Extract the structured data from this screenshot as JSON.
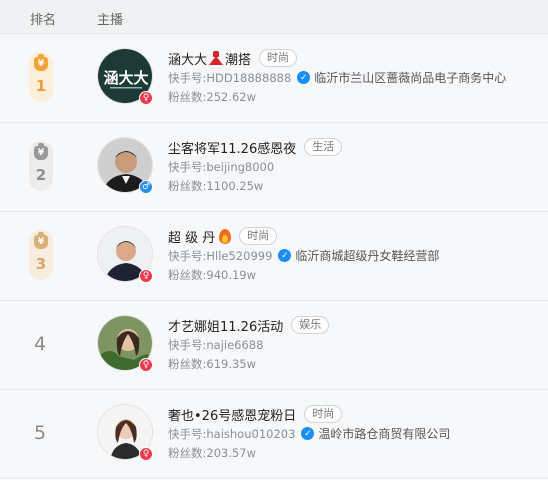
{
  "header": {
    "rank_label": "排名",
    "host_label": "主播"
  },
  "id_prefix": "快手号:",
  "fans_prefix": "粉丝数:",
  "rows": [
    {
      "rank": "1",
      "medal": "gold",
      "name": "涵大大",
      "name_suffix": "潮搭",
      "name_emoji": "dress",
      "tag": "时尚",
      "id": "HDD18888888",
      "verified": true,
      "company": "临沂市兰山区蔷薇尚品电子商务中心",
      "fans": "252.62w",
      "gender": "female",
      "avatar_text": "涵大大"
    },
    {
      "rank": "2",
      "medal": "silver",
      "name": "尘客将军11.26感恩夜",
      "tag": "生活",
      "id": "beijing8000",
      "verified": false,
      "company": "",
      "fans": "1100.25w",
      "gender": "male"
    },
    {
      "rank": "3",
      "medal": "bronze",
      "name": "超 级 丹",
      "name_emoji": "fire",
      "tag": "时尚",
      "id": "Hlle520999",
      "verified": true,
      "company": "临沂商城超级丹女鞋经营部",
      "fans": "940.19w",
      "gender": "female"
    },
    {
      "rank": "4",
      "medal": "none",
      "name": "才艺娜姐11.26活动",
      "tag": "娱乐",
      "id": "najie6688",
      "verified": false,
      "company": "",
      "fans": "619.35w",
      "gender": "female"
    },
    {
      "rank": "5",
      "medal": "none",
      "name": "奢也•26号感恩宠粉日",
      "tag": "时尚",
      "id": "haishou010203",
      "verified": true,
      "company": "温岭市路仓商贸有限公司",
      "fans": "203.57w",
      "gender": "female"
    }
  ],
  "colors": {
    "gold": "#f0a43a",
    "silver": "#9a9a9a",
    "bronze": "#d9b077",
    "verify_blue": "#1a8ef5",
    "female_red": "#ee3a4e",
    "male_blue": "#2a8ff0"
  },
  "icons": {
    "medal": "money-bag-icon",
    "verified": "verified-check-icon",
    "female": "female-symbol-icon",
    "male": "male-symbol-icon"
  }
}
